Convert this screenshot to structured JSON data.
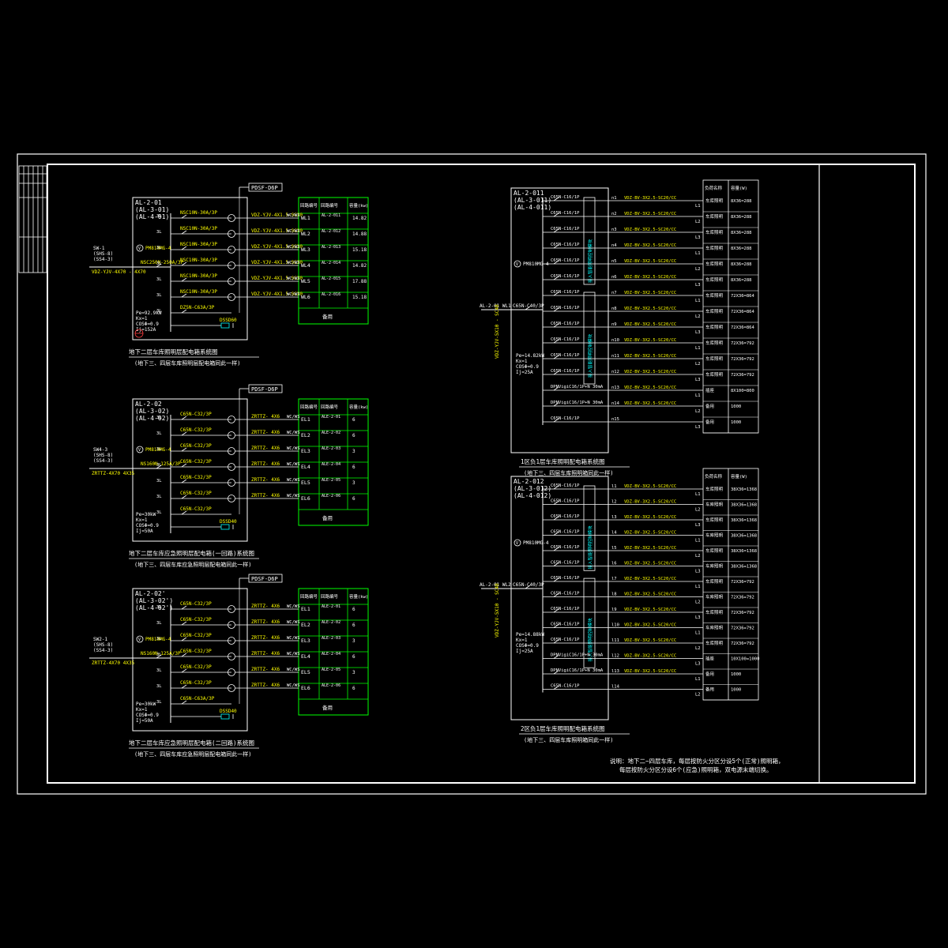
{
  "d1": {
    "box": [
      "AL-2-01",
      "(AL-3-01)",
      "(AL-4-01)"
    ],
    "tag": "PDSF-D6P",
    "headers": [
      "回路编号",
      "回路编号",
      "容量(kw)"
    ],
    "rows": [
      {
        "brk": "NSC10N-30A/3P",
        "cable": "VDZ-YJV-4X1.5-SC20",
        "lay": "WC/WS",
        "circ": "WL1",
        "dest": "AL-2-011",
        "kw": "14.82"
      },
      {
        "brk": "NSC10N-30A/3P",
        "cable": "VDZ-YJV-4X1.5-SC20",
        "lay": "WC/WS",
        "circ": "WL2",
        "dest": "AL-2-012",
        "kw": "14.88"
      },
      {
        "brk": "NSC10N-30A/3P",
        "cable": "VDZ-YJV-4X1.5-SC20",
        "lay": "WC/WS",
        "circ": "WL3",
        "dest": "AL-2-013",
        "kw": "15.18"
      },
      {
        "brk": "NSC10N-30A/3P",
        "cable": "VDZ-YJV-4X1.5-SC20",
        "lay": "WC/WS",
        "circ": "WL4",
        "dest": "AL-2-014",
        "kw": "14.82"
      },
      {
        "brk": "NSC10N-30A/3P",
        "cable": "VDZ-YJV-4X1.5-SC20",
        "lay": "WC/WS",
        "circ": "WL5",
        "dest": "AL-2-015",
        "kw": "17.88"
      },
      {
        "brk": "NSC10N-30A/3P",
        "cable": "VDZ-YJV-4X1.5-SC20",
        "lay": "WC/WS",
        "circ": "WL6",
        "dest": "AL-2-016",
        "kw": "15.18"
      }
    ],
    "spare": "备用",
    "spare_brk": "DZ5N-C63A/3P",
    "spd": "DSSD60",
    "meter": "PM810MG-4",
    "main_brk": "NSC250N-250A/3P",
    "feed": [
      "SW-1",
      "(SHS-8)",
      "(SS4-3)"
    ],
    "feed_cable": "VDZ-YJV-4X70 - 4X70",
    "params": [
      "Pe=92.9kW",
      "Kx=1",
      "COSΦ=0.9",
      "Ij=152A"
    ],
    "caption": "地下二层车库照明层配电箱系统图",
    "subcaption": "(地下三、四层车库照明层配电箱同此一样)"
  },
  "d2": {
    "box": [
      "AL-2-02",
      "(AL-3-02)",
      "(AL-4-02)"
    ],
    "tag": "PDSF-D6P",
    "headers": [
      "回路编号",
      "回路编号",
      "容量(kw)"
    ],
    "rows": [
      {
        "brk": "C65N-C32/3P",
        "cable": "ZRTTZ- 4X6",
        "lay": "WC/WS",
        "circ": "EL1",
        "dest": "ALE-2-01",
        "kw": "6"
      },
      {
        "brk": "C65N-C32/3P",
        "cable": "ZRTTZ- 4X6",
        "lay": "WC/WS",
        "circ": "EL2",
        "dest": "ALE-2-02",
        "kw": "6"
      },
      {
        "brk": "C65N-C32/3P",
        "cable": "ZRTTZ- 4X6",
        "lay": "WC/WS",
        "circ": "EL3",
        "dest": "ALE-2-03",
        "kw": "3"
      },
      {
        "brk": "C65N-C32/3P",
        "cable": "ZRTTZ- 4X6",
        "lay": "WC/WS",
        "circ": "EL4",
        "dest": "ALE-2-04",
        "kw": "6"
      },
      {
        "brk": "C65N-C32/3P",
        "cable": "ZRTTZ- 4X6",
        "lay": "WC/WS",
        "circ": "EL5",
        "dest": "ALE-2-05",
        "kw": "3"
      },
      {
        "brk": "C65N-C32/3P",
        "cable": "ZRTTZ- 4X6",
        "lay": "WC/WS",
        "circ": "EL6",
        "dest": "ALE-2-06",
        "kw": "6"
      }
    ],
    "spare": "备用",
    "spare_brk": "C65N-C32/3P",
    "spd": "DSSD40",
    "meter": "PM810MG-4",
    "main_brk": "NS160N-125A/3P",
    "feed": [
      "SW4-3",
      "(SHS-8)",
      "(SS4-3)"
    ],
    "feed_cable": "ZRTTZ-4X70 4X35",
    "params": [
      "Pe=30kW",
      "Kx=1",
      "COSΦ=0.9",
      "Ij=50A"
    ],
    "caption": "地下二层车库应急照明层配电箱(一回路)系统图",
    "subcaption": "(地下三、四层车库应急照明层配电箱同此一样)"
  },
  "d3": {
    "box": [
      "AL-2-02'",
      "(AL-3-02')",
      "(AL-4-02')"
    ],
    "tag": "PDSF-D6P",
    "headers": [
      "回路编号",
      "回路编号",
      "容量(kw)"
    ],
    "rows": [
      {
        "brk": "C65N-C32/3P",
        "cable": "ZRTTZ- 4X6",
        "lay": "WC/WS",
        "circ": "EL1",
        "dest": "ALE-2-01",
        "kw": "6"
      },
      {
        "brk": "C65N-C32/3P",
        "cable": "ZRTTZ- 4X6",
        "lay": "WC/WS",
        "circ": "EL2",
        "dest": "ALE-2-02",
        "kw": "6"
      },
      {
        "brk": "C65N-C32/3P",
        "cable": "ZRTTZ- 4X6",
        "lay": "WC/WS",
        "circ": "EL3",
        "dest": "ALE-2-03",
        "kw": "3"
      },
      {
        "brk": "C65N-C32/3P",
        "cable": "ZRTTZ- 4X6",
        "lay": "WC/WS",
        "circ": "EL4",
        "dest": "ALE-2-04",
        "kw": "6"
      },
      {
        "brk": "C65N-C32/3P",
        "cable": "ZRTTZ- 4X6",
        "lay": "WC/WS",
        "circ": "EL5",
        "dest": "ALE-2-05",
        "kw": "3"
      },
      {
        "brk": "C65N-C32/3P",
        "cable": "ZRTTZ- 4X6",
        "lay": "WC/WS",
        "circ": "EL6",
        "dest": "ALE-2-06",
        "kw": "6"
      }
    ],
    "spare": "备用",
    "spare_brk": "C65N-C63A/3P",
    "spd": "DSSD40",
    "meter": "PM810MG-4",
    "main_brk": "NS160N-125A/3P",
    "feed": [
      "SW2-1",
      "(SHS-8)",
      "(SS4-3)"
    ],
    "feed_cable": "ZRTTZ-4X70 4X35",
    "params": [
      "Pe=30kW",
      "Kx=1",
      "COSΦ=0.9",
      "Ij=50A"
    ],
    "caption": "地下二层车库应急照明层配电箱(二回路)系统图",
    "subcaption": "(地下三、四层车库应急照明层配电箱同此一样)"
  },
  "d4": {
    "box": [
      "AL-2-011",
      "(AL-3-011)",
      "(AL-4-011)"
    ],
    "headers": [
      "负荷名称",
      "容量(W)"
    ],
    "meter": "PM810MG-4",
    "main_brk": "C65N-C40/3P",
    "feed": "AL-2-01 WL1",
    "feed_cable": "VDZ-YJV-5X10 - SC40",
    "side_cable": "VDZ-YJV-5X10 - SC40",
    "phase_label": "接入智能照明控制模块",
    "params": [
      "Pe=14.82kW",
      "Kx=1",
      "COSΦ=0.9",
      "Ij=25A"
    ],
    "rows": [
      {
        "brk": "C65N-C16/1P",
        "no": "n1",
        "cable": "VDZ-BV-3X2.5-SC20/CC",
        "ph": "L1",
        "load": "车库照明",
        "w": "8X36=288"
      },
      {
        "brk": "C65N-C16/1P",
        "no": "n2",
        "cable": "VDZ-BV-3X2.5-SC20/CC",
        "ph": "L2",
        "load": "车库照明",
        "w": "8X36=288"
      },
      {
        "brk": "C65N-C16/1P",
        "no": "n3",
        "cable": "VDZ-BV-3X2.5-SC20/CC",
        "ph": "L3",
        "load": "车库照明",
        "w": "8X36=288"
      },
      {
        "brk": "C65N-C16/1P",
        "no": "n4",
        "cable": "VDZ-BV-3X2.5-SC20/CC",
        "ph": "L1",
        "load": "车库照明",
        "w": "8X36=288"
      },
      {
        "brk": "C65N-C16/1P",
        "no": "n5",
        "cable": "VDZ-BV-3X2.5-SC20/CC",
        "ph": "L2",
        "load": "车库照明",
        "w": "8X36=288"
      },
      {
        "brk": "C65N-C16/1P",
        "no": "n6",
        "cable": "VDZ-BV-3X2.5-SC20/CC",
        "ph": "L3",
        "load": "车库照明",
        "w": "8X36=288"
      },
      {
        "brk": "C65N-C16/1P",
        "no": "n7",
        "cable": "VDZ-BV-3X2.5-SC20/CC",
        "ph": "L1",
        "load": "车库照明",
        "w": "72X36=864"
      },
      {
        "brk": "C65N-C16/1P",
        "no": "n8",
        "cable": "VDZ-BV-3X2.5-SC20/CC",
        "ph": "L2",
        "load": "车库照明",
        "w": "72X36=864"
      },
      {
        "brk": "C65N-C16/1P",
        "no": "n9",
        "cable": "VDZ-BV-3X2.5-SC20/CC",
        "ph": "L3",
        "load": "车库照明",
        "w": "72X36=864"
      },
      {
        "brk": "C65N-C16/1P",
        "no": "n10",
        "cable": "VDZ-BV-3X2.5-SC20/CC",
        "ph": "L1",
        "load": "车库照明",
        "w": "72X36=792"
      },
      {
        "brk": "C65N-C16/1P",
        "no": "n11",
        "cable": "VDZ-BV-3X2.5-SC20/CC",
        "ph": "L2",
        "load": "车库照明",
        "w": "72X36=792"
      },
      {
        "brk": "C65N-C16/1P",
        "no": "n12",
        "cable": "VDZ-BV-3X2.5-SC20/CC",
        "ph": "L3",
        "load": "车库照明",
        "w": "72X36=792"
      },
      {
        "brk": "DPNVigiC16/1P+N 30mA",
        "no": "n13",
        "cable": "VDZ-BV-3X2.5-SC20/CC",
        "ph": "L1",
        "load": "插座",
        "w": "8X100=800"
      },
      {
        "brk": "DPNVigiC16/1P+N 30mA",
        "no": "n14",
        "cable": "VDZ-BV-3X2.5-SC20/CC",
        "ph": "L2",
        "load": "备用",
        "w": "1000"
      },
      {
        "brk": "C65N-C16/1P",
        "no": "n15",
        "cable": "",
        "ph": "L3",
        "load": "备用",
        "w": "1000"
      }
    ],
    "caption": "1区负1层车库照明配电箱系统图",
    "subcaption": "(地下三、四层车库照明箱同此一样)"
  },
  "d5": {
    "box": [
      "AL-2-012",
      "(AL-3-012)",
      "(AL-4-012)"
    ],
    "headers": [
      "负荷名称",
      "容量(W)"
    ],
    "meter": "PM810MG-4",
    "main_brk": "C65N-C40/3P",
    "feed": "AL-2-01 WL2",
    "feed_cable": "VDZ-YJV-5X10 - SC40",
    "side_cable": "VDZ-YJV-5X10 - SC40",
    "phase_label": "接入智能照明控制模块",
    "params": [
      "Pe=14.88kW",
      "Kx=1",
      "COSΦ=0.9",
      "Ij=25A"
    ],
    "rows": [
      {
        "brk": "C65N-C16/1P",
        "no": "l1",
        "cable": "VDZ-BV-3X2.5-SC20/CC",
        "ph": "L1",
        "load": "车库照明",
        "w": "38X36=1368"
      },
      {
        "brk": "C65N-C16/1P",
        "no": "l2",
        "cable": "VDZ-BV-3X2.5-SC20/CC",
        "ph": "L2",
        "load": "车库照明",
        "w": "38X36=1368"
      },
      {
        "brk": "C65N-C16/1P",
        "no": "l3",
        "cable": "VDZ-BV-3X2.5-SC20/CC",
        "ph": "L3",
        "load": "车库照明",
        "w": "38X36=1368"
      },
      {
        "brk": "C65N-C16/1P",
        "no": "l4",
        "cable": "VDZ-BV-3X2.5-SC20/CC",
        "ph": "L1",
        "load": "车库照明",
        "w": "38X36=1368"
      },
      {
        "brk": "C65N-C16/1P",
        "no": "l5",
        "cable": "VDZ-BV-3X2.5-SC20/CC",
        "ph": "L2",
        "load": "车库照明",
        "w": "38X36=1368"
      },
      {
        "brk": "C65N-C16/1P",
        "no": "l6",
        "cable": "VDZ-BV-3X2.5-SC20/CC",
        "ph": "L3",
        "load": "车库照明",
        "w": "38X36=1368"
      },
      {
        "brk": "C65N-C16/1P",
        "no": "l7",
        "cable": "VDZ-BV-3X2.5-SC20/CC",
        "ph": "L1",
        "load": "车库照明",
        "w": "72X36=792"
      },
      {
        "brk": "C65N-C16/1P",
        "no": "l8",
        "cable": "VDZ-BV-3X2.5-SC20/CC",
        "ph": "L2",
        "load": "车库照明",
        "w": "72X36=792"
      },
      {
        "brk": "C65N-C16/1P",
        "no": "l9",
        "cable": "VDZ-BV-3X2.5-SC20/CC",
        "ph": "L3",
        "load": "车库照明",
        "w": "72X36=792"
      },
      {
        "brk": "C65N-C16/1P",
        "no": "l10",
        "cable": "VDZ-BV-3X2.5-SC20/CC",
        "ph": "L1",
        "load": "车库照明",
        "w": "72X36=792"
      },
      {
        "brk": "C65N-C16/1P",
        "no": "l11",
        "cable": "VDZ-BV-3X2.5-SC20/CC",
        "ph": "L2",
        "load": "车库照明",
        "w": "72X36=792"
      },
      {
        "brk": "DPNVigiC16/1P+N 30mA",
        "no": "l12",
        "cable": "VDZ-BV-3X2.5-SC20/CC",
        "ph": "L3",
        "load": "插座",
        "w": "10X100=1000"
      },
      {
        "brk": "DPNVigiC16/1P+N 30mA",
        "no": "l13",
        "cable": "VDZ-BV-3X2.5-SC20/CC",
        "ph": "L1",
        "load": "备用",
        "w": "1000"
      },
      {
        "brk": "C65N-C16/1P",
        "no": "l14",
        "cable": "",
        "ph": "L2",
        "load": "备用",
        "w": "1000"
      }
    ],
    "caption": "2区负1层车库照明配电箱系统图",
    "subcaption": "(地下三、四层车库照明箱同此一样)"
  },
  "note": {
    "line1": "说明：地下二~四层车库，每层按防火分区分设5个(正常)照明箱，",
    "line2": "每层按防火分区分设6个(应急)照明箱，双电源末端切换。"
  },
  "colors": {
    "bg": "#000000",
    "frame": "#ffffff",
    "panel": "#ffffff",
    "wire": "#ffffff",
    "text": "#ffff00",
    "table": "#00ff00",
    "accent": "#00ffff"
  }
}
